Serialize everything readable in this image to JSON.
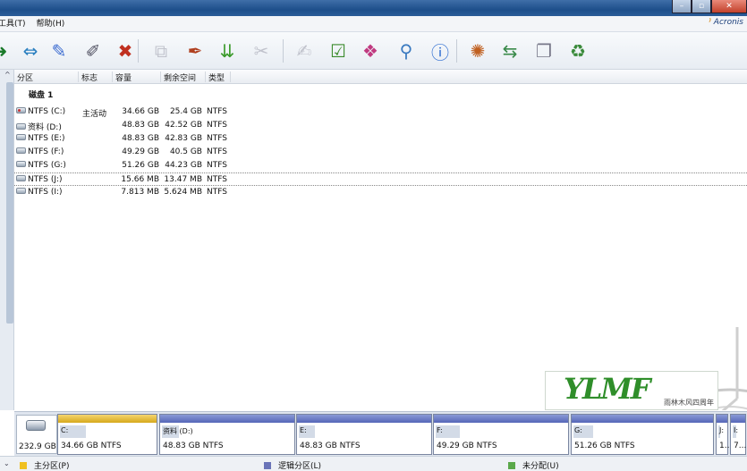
{
  "menu": {
    "items": [
      "工具(T)",
      "帮助(H)"
    ],
    "brand": "Acronis"
  },
  "toolbar": {
    "buttons": [
      {
        "name": "arrow-icon",
        "glyph": "➜"
      },
      {
        "name": "resize-partition-icon",
        "glyph": "⇔"
      },
      {
        "name": "check-partition-icon",
        "glyph": "✎"
      },
      {
        "name": "create-partition-icon",
        "glyph": "✐"
      },
      {
        "name": "delete-partition-icon",
        "glyph": "✖"
      },
      {
        "name": "copy-partition-icon",
        "glyph": "⧉"
      },
      {
        "name": "format-partition-icon",
        "glyph": "✒"
      },
      {
        "name": "merge-partition-icon",
        "glyph": "⇊"
      },
      {
        "name": "split-partition-icon",
        "glyph": "✂"
      },
      {
        "name": "brush-icon",
        "glyph": "✍"
      },
      {
        "name": "commit-icon",
        "glyph": "☑"
      },
      {
        "name": "package-icon",
        "glyph": "❖"
      },
      {
        "name": "search-icon",
        "glyph": "⚲"
      },
      {
        "name": "info-icon",
        "glyph": "ⓘ"
      },
      {
        "name": "recovery-icon",
        "glyph": "✺"
      },
      {
        "name": "migrate-icon",
        "glyph": "⇆"
      },
      {
        "name": "clone-icon",
        "glyph": "❐"
      },
      {
        "name": "recycle-icon",
        "glyph": "♻"
      }
    ]
  },
  "table": {
    "columns": [
      "分区",
      "标志",
      "容量",
      "剩余空间",
      "类型"
    ],
    "disk_label": "磁盘 1",
    "rows": [
      {
        "partition": "NTFS (C:)",
        "flag": "主活动",
        "capacity": "34.66 GB",
        "free": "25.4 GB",
        "type": "NTFS"
      },
      {
        "partition": "资料 (D:)",
        "flag": "",
        "capacity": "48.83 GB",
        "free": "42.52 GB",
        "type": "NTFS"
      },
      {
        "partition": "NTFS (E:)",
        "flag": "",
        "capacity": "48.83 GB",
        "free": "42.83 GB",
        "type": "NTFS"
      },
      {
        "partition": "NTFS (F:)",
        "flag": "",
        "capacity": "49.29 GB",
        "free": "40.5 GB",
        "type": "NTFS"
      },
      {
        "partition": "NTFS (G:)",
        "flag": "",
        "capacity": "51.26 GB",
        "free": "44.23 GB",
        "type": "NTFS"
      },
      {
        "partition": "NTFS (J:)",
        "flag": "",
        "capacity": "15.66 MB",
        "free": "13.47 MB",
        "type": "NTFS"
      },
      {
        "partition": "NTFS (I:)",
        "flag": "",
        "capacity": "7.813 MB",
        "free": "5.624 MB",
        "type": "NTFS"
      }
    ]
  },
  "watermark": {
    "logo": "YLMF",
    "sub": "雨林木风四周年"
  },
  "diskmap": {
    "disk_size": "232.9 GB",
    "partitions": [
      {
        "name": "C:",
        "info": "34.66 GB  NTFS",
        "kind": "primary",
        "used": 0.27
      },
      {
        "name": "资料 (D:)",
        "info": "48.83 GB  NTFS",
        "kind": "logical",
        "used": 0.13
      },
      {
        "name": "E:",
        "info": "48.83 GB  NTFS",
        "kind": "logical",
        "used": 0.12
      },
      {
        "name": "F:",
        "info": "49.29 GB  NTFS",
        "kind": "logical",
        "used": 0.18
      },
      {
        "name": "G:",
        "info": "51.26 GB  NTFS",
        "kind": "logical",
        "used": 0.14
      },
      {
        "name": "J:",
        "info": "1...",
        "kind": "logical",
        "used": 0.14
      },
      {
        "name": "I:",
        "info": "7...",
        "kind": "logical",
        "used": 0.28
      }
    ]
  },
  "legend": {
    "primary": "主分区(P)",
    "logical": "逻辑分区(L)",
    "unallocated": "未分配(U)"
  },
  "colors": {
    "primary": "#f0c020",
    "logical": "#6a74b8",
    "unallocated": "#5aa84a"
  }
}
